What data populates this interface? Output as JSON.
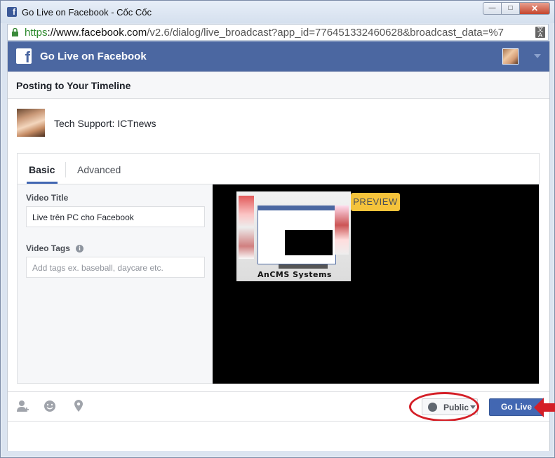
{
  "browser": {
    "window_title": "Go Live on Facebook - Cốc Cốc",
    "url_scheme": "https",
    "url_host": "://www.facebook.com",
    "url_rest": "/v2.6/dialog/live_broadcast?app_id=776451332460628&broadcast_data=%7",
    "minimize": "—",
    "maximize": "□",
    "close": "✕"
  },
  "header": {
    "title": "Go Live on Facebook"
  },
  "posting": {
    "label": "Posting to Your Timeline"
  },
  "page": {
    "name": "Tech Support: ICTnews"
  },
  "tabs": [
    {
      "label": "Basic",
      "active": true
    },
    {
      "label": "Advanced",
      "active": false
    }
  ],
  "form": {
    "video_title_label": "Video Title",
    "video_title_value": "Live trên PC cho Facebook",
    "video_tags_label": "Video Tags",
    "video_tags_placeholder": "Add tags ex. baseball, daycare etc."
  },
  "preview": {
    "badge": "PREVIEW",
    "thumbnail_brand": "AnCMS Systems"
  },
  "footer": {
    "privacy_label": "Public",
    "go_live_label": "Go Live"
  },
  "colors": {
    "facebook_blue": "#4b67a1",
    "button_blue": "#4267b2",
    "preview_badge": "#f5c33b",
    "annotation_red": "#d41f27"
  }
}
